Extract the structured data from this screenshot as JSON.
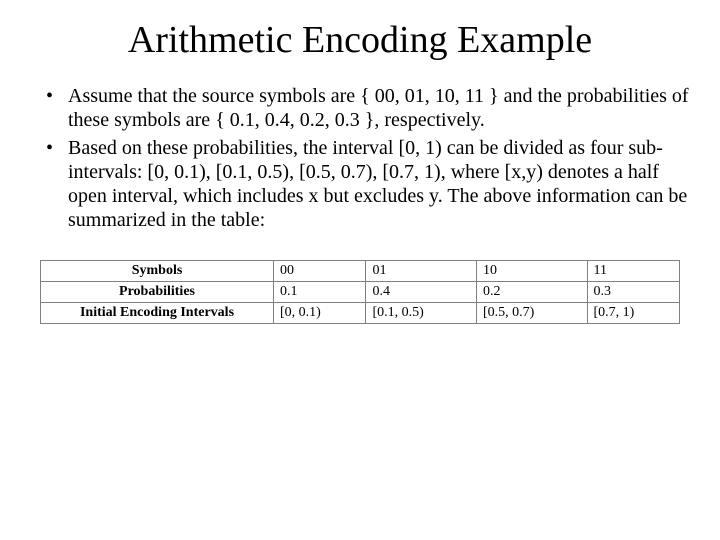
{
  "title": "Arithmetic Encoding Example",
  "bullets": [
    "Assume that the source symbols are { 00, 01, 10, 11 } and the probabilities of these symbols are { 0.1, 0.4, 0.2, 0.3 }, respectively.",
    "Based on these probabilities, the interval [0, 1) can be divided as four sub-intervals: [0, 0.1), [0.1, 0.5), [0.5, 0.7), [0.7, 1), where [x,y) denotes a half open interval, which includes x but excludes y. The above information can be summarized in the table:"
  ],
  "table": {
    "row_headers": [
      "Symbols",
      "Probabilities",
      "Initial Encoding Intervals"
    ],
    "columns": [
      {
        "symbol": "00",
        "prob": "0.1",
        "interval": "[0, 0.1)"
      },
      {
        "symbol": "01",
        "prob": "0.4",
        "interval": "[0.1, 0.5)"
      },
      {
        "symbol": "10",
        "prob": "0.2",
        "interval": "[0.5, 0.7)"
      },
      {
        "symbol": "11",
        "prob": "0.3",
        "interval": "[0.7, 1)"
      }
    ]
  },
  "chart_data": {
    "type": "table",
    "title": "Arithmetic Encoding Example",
    "row_headers": [
      "Symbols",
      "Probabilities",
      "Initial Encoding Intervals"
    ],
    "data": [
      [
        "00",
        "01",
        "10",
        "11"
      ],
      [
        0.1,
        0.4,
        0.2,
        0.3
      ],
      [
        "[0, 0.1)",
        "[0.1, 0.5)",
        "[0.5, 0.7)",
        "[0.7, 1)"
      ]
    ]
  }
}
